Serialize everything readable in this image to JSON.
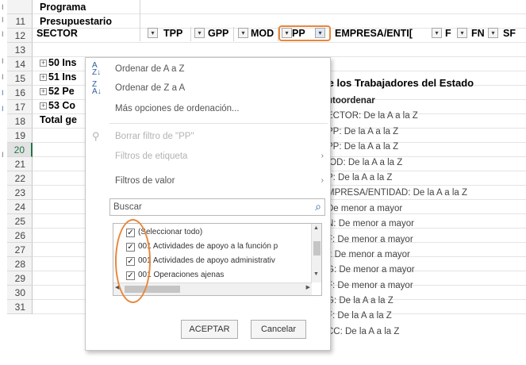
{
  "sheet": {
    "rows": [
      {
        "num": "",
        "text": "Programa"
      },
      {
        "num": "11",
        "text": "Presupuestario"
      },
      {
        "num": "12",
        "text": ""
      },
      {
        "num": "13",
        "text": "50 Ins"
      },
      {
        "num": "14",
        "text": "51 Ins"
      },
      {
        "num": "15",
        "text": "52 Pe"
      },
      {
        "num": "16",
        "text": "53 Co"
      },
      {
        "num": "17",
        "text": "Total ge"
      },
      {
        "num": "18",
        "text": ""
      },
      {
        "num": "19",
        "text": ""
      },
      {
        "num": "20",
        "text": ""
      },
      {
        "num": "21",
        "text": ""
      },
      {
        "num": "22",
        "text": ""
      },
      {
        "num": "23",
        "text": ""
      },
      {
        "num": "24",
        "text": ""
      },
      {
        "num": "25",
        "text": ""
      },
      {
        "num": "26",
        "text": ""
      },
      {
        "num": "27",
        "text": ""
      },
      {
        "num": "28",
        "text": ""
      },
      {
        "num": "29",
        "text": ""
      },
      {
        "num": "30",
        "text": ""
      },
      {
        "num": "31",
        "text": ""
      }
    ],
    "selected_row": "20",
    "headers": [
      "SECTOR",
      "TPP",
      "GPP",
      "MOD",
      "PP",
      "EMPRESA/ENTI[",
      "F",
      "FN",
      "SF"
    ],
    "pp_extra": "le los Trabajadores del Estado"
  },
  "sort_list": {
    "heading": "utoordenar",
    "items": [
      "ECTOR: De la A a la Z",
      "PP: De la A a la Z",
      "PP: De la A a la Z",
      "IOD: De la A a la Z",
      "P: De la A a la Z",
      "MPRESA/ENTIDAD: De la A a la Z",
      "De menor a mayor",
      "N: De menor a mayor",
      "F: De menor a mayor",
      "I: De menor a mayor",
      "G: De menor a mayor",
      "F: De menor a mayor",
      "G: De la A a la Z",
      "F: De la A a la Z",
      "CC: De la A a la Z"
    ]
  },
  "menu": {
    "sort_az": "Ordenar de A a Z",
    "sort_za": "Ordenar de Z a A",
    "more_sort": "Más opciones de ordenación...",
    "clear_filter": "Borrar filtro de \"PP\"",
    "label_filters": "Filtros de etiqueta",
    "value_filters": "Filtros de valor",
    "search_placeholder": "Buscar",
    "list": [
      {
        "label": "(Seleccionar todo)",
        "checked": true
      },
      {
        "label": "001 Actividades de apoyo a la función p",
        "checked": true
      },
      {
        "label": "001 Actividades de apoyo administrativ",
        "checked": true
      },
      {
        "label": "001 Operaciones ajenas",
        "checked": true
      }
    ],
    "ok": "ACEPTAR",
    "cancel": "Cancelar"
  },
  "icons": {
    "sort_az": "sort-ascending-icon",
    "sort_za": "sort-descending-icon",
    "clear_filter": "clear-filter-icon",
    "search": "search-icon",
    "checkbox": "checkmark-icon"
  },
  "colors": {
    "highlight": "#e8873b",
    "selected_row": "#217346"
  }
}
